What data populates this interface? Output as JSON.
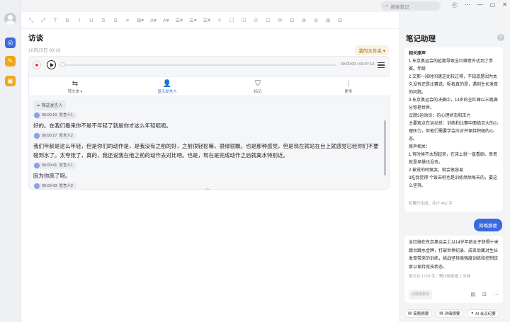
{
  "titlebar": {
    "search_placeholder": "搜索笔记",
    "window_controls": [
      "ⓔ",
      "⋯",
      "—",
      "▢",
      "✕"
    ]
  },
  "leftbar": {
    "items": [
      {
        "icon": "globe-icon",
        "color": "#3b6ae0",
        "glyph": "◎"
      },
      {
        "icon": "notes-pen-icon",
        "color": "#f2a516",
        "glyph": "✎"
      },
      {
        "icon": "folder-icon",
        "color": "#f2a516",
        "glyph": "▣"
      }
    ]
  },
  "toolbar": {
    "items": [
      "⤡",
      "⤢",
      "T",
      "B",
      "I",
      "U",
      "S",
      "S",
      "≡",
      "⊞▾",
      "A▾",
      "A▾",
      "☰▾",
      "☰▾",
      "☰▾",
      "◊",
      "☐",
      "☑",
      "⊙",
      "⊡",
      "✉",
      "⊟",
      "⊕",
      "⊘",
      "⊞",
      "⊟"
    ]
  },
  "document": {
    "title": "访谈",
    "date": "10月25日 00:10",
    "folder": "我的文件夹 ▾"
  },
  "player": {
    "time": "00:00:00 / 00:07:13"
  },
  "actions": [
    {
      "icon": "translate-icon",
      "glyph": "⇆",
      "label": "转文本 ▾",
      "active": false
    },
    {
      "icon": "speaker-icon",
      "glyph": "👤",
      "label": "显示发言人",
      "active": true
    },
    {
      "icon": "bookmark-icon",
      "glyph": "⛉",
      "label": "标记",
      "active": false
    },
    {
      "icon": "more-icon",
      "glyph": "⋮",
      "label": "更多",
      "active": false
    }
  ],
  "filter_label": "筛选发言人",
  "transcript": [
    {
      "time": "00:00:10",
      "speaker": "发言人1",
      "text": "好的。在我们看来你不是不年轻了就是你才这么年轻呃呃。"
    },
    {
      "time": "00:00:17",
      "speaker": "发言人2",
      "text": "我们年龄是这么年轻，但是你们的动作是，是我没有之前的好，之前很轻松嘛，很绿很飘。也是那种感觉，但是现在就站在台上就感觉已经你们不要碰到水了。太夸张了，真的，我还说我在他之前的动作去对比吧。也是，现在是完成动作之后就离水特别近。"
    },
    {
      "time": "00:00:41",
      "speaker": "发言人1",
      "text": "因为你高了呀。"
    },
    {
      "time": "00:00:43",
      "speaker": "发言人2",
      "text": ""
    }
  ],
  "assistant": {
    "title": "笔记助理",
    "card1_lines": [
      {
        "text": "相关原声",
        "bold": true
      },
      {
        "text": "1.东京奥运会的延期导致全红婵意外达到了参赛。年龄",
        "bold": false
      },
      {
        "text": "2.文那一段时间速芝比较过得，不知道是因为太久没有还是比赛说，呃我真的是，遇到生长发育的问题。",
        "bold": false
      },
      {
        "text": "3.东京奥运会的决赛中，14岁的全红婵以三跳满分惊艳世界。",
        "bold": false
      },
      {
        "text": "议题3运动员：的心理状态和压力",
        "bold": false,
        "prefix": "议题3"
      },
      {
        "text": "主要观点在运动员：训练和比赛中面临巨大的心理压力，但他们需要学会应对并保持积极的心态。",
        "bold": false,
        "prefix": "主要观点"
      },
      {
        "text": "原声相关：",
        "bold": false
      },
      {
        "text": "1.有时候不太想起来，在床上就一直看剧、意思就是早操也没去。",
        "bold": false
      },
      {
        "text": "2.被说的时候哭，就会很容易",
        "bold": false
      },
      {
        "text": "3吃我觉得 个饭去吧也是训练然后每天的，要这么坚持。",
        "bold": false
      }
    ],
    "card1_meta": "纪要已生成，共计 452 字",
    "bubble": "简略摘要",
    "card2_text": "全红婵在东京奥运会上以14岁年龄女子获得十米跳台跳水金牌，打破世界纪录、成名后面对生长发育带来的训练，挑战坚持高强度训练和控制饮食以保持竞技状态。",
    "card2_meta": "原文共 1720 字，预计阅读省 1 分钟",
    "copy_btn": "点链接复制",
    "foot_icons": [
      "doc-icon",
      "export-icon",
      "more-h-icon"
    ],
    "bottom_buttons": [
      {
        "icon": "summary-icon",
        "label": "简略摘要"
      },
      {
        "icon": "detail-icon",
        "label": "详细摘要"
      },
      {
        "icon": "ai-icon",
        "label": "AI 会议纪要"
      }
    ]
  }
}
